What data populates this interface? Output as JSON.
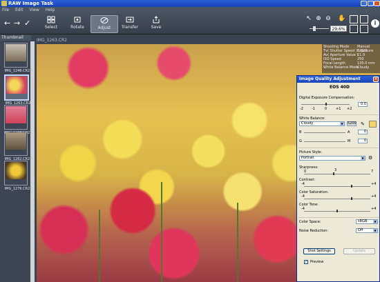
{
  "window": {
    "title": "RAW Image Task"
  },
  "menu": [
    "File",
    "Edit",
    "View",
    "Help"
  ],
  "toolbar": {
    "buttons": [
      {
        "label": "Select",
        "icon": "grid-icon"
      },
      {
        "label": "Rotate",
        "icon": "rotate-icon"
      },
      {
        "label": "Adjust",
        "icon": "adjust-icon",
        "active": true
      },
      {
        "label": "Transfer",
        "icon": "transfer-icon"
      },
      {
        "label": "Save",
        "icon": "save-icon"
      }
    ],
    "zoom": "29,6%"
  },
  "thumbnails": {
    "header": "Thumbnail",
    "items": [
      {
        "label": "IMG_1246.CR2",
        "selected": false
      },
      {
        "label": "IMG_1263.CR2",
        "selected": true
      },
      {
        "label": "IMG_1248.CR2",
        "selected": false
      },
      {
        "label": "IMG_1262.CR2",
        "selected": false
      },
      {
        "label": "IMG_1276.CR2",
        "selected": false
      }
    ]
  },
  "main": {
    "filename": "IMG_1263.CR2"
  },
  "shooting_info": [
    {
      "k": "Shooting Mode",
      "v": "Manual Exposure"
    },
    {
      "k": "Tv( Shutter Speed )",
      "v": "1/320"
    },
    {
      "k": "Av( Aperture Value )",
      "v": "11.0"
    },
    {
      "k": "ISO Speed",
      "v": "250"
    },
    {
      "k": "Focal Length",
      "v": "135.0 mm"
    },
    {
      "k": "White Balance Mode",
      "v": "Cloudy"
    }
  ],
  "dialog": {
    "title": "Image Quality Adjustment",
    "camera": "EOS 40D",
    "exposure_label": "Digital Exposure Compensation:",
    "exposure_scale": [
      "-2",
      "-1",
      "0",
      "+1",
      "+2"
    ],
    "exposure_value": "0.0",
    "wb_label": "White Balance:",
    "wb_value": "Cloudy",
    "wb_kelvin": "5200",
    "wb_b": "B",
    "wb_a": "A",
    "wb_g": "G",
    "wb_m": "M",
    "wb_shift_1": "0",
    "wb_shift_2": "0",
    "ps_label": "Picture Style:",
    "ps_value": "Portrait",
    "sharpness_label": "Sharpness:",
    "sharpness_scale": [
      "0",
      "7"
    ],
    "sharpness_value": "3",
    "contrast_label": "Contrast:",
    "contrast_scale": [
      "-4",
      "+4"
    ],
    "saturation_label": "Color Saturation:",
    "saturation_scale": [
      "-4",
      "+4"
    ],
    "tone_label": "Color Tone:",
    "tone_scale": [
      "-4",
      "+4"
    ],
    "colorspace_label": "Color Space:",
    "colorspace_value": "sRGB",
    "nr_label": "Noise Reduction:",
    "nr_value": "Off",
    "shot_settings": "Shot Settings",
    "update": "Update",
    "preview_label": "Preview"
  }
}
